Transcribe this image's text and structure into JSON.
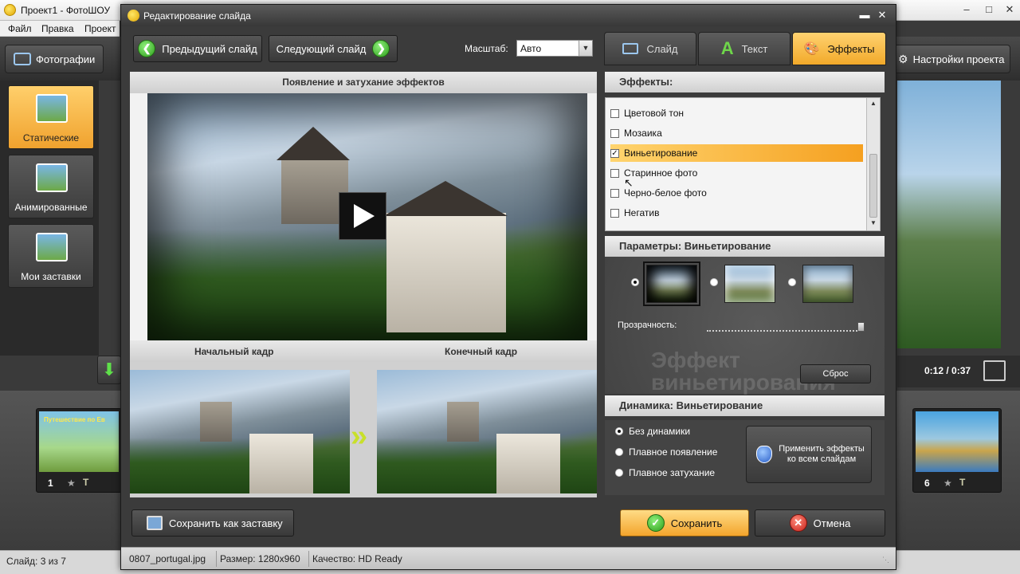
{
  "main_window": {
    "title": "Проект1 - ФотоШОУ",
    "menu": [
      "Файл",
      "Правка",
      "Проект"
    ],
    "toolbar": {
      "photos_label": "Фотографии",
      "settings_label": "Настройки проекта"
    },
    "categories": [
      {
        "label": "Статические",
        "active": true
      },
      {
        "label": "Анимированные",
        "active": false
      },
      {
        "label": "Мои заставки",
        "active": false
      }
    ],
    "playback_time": "0:12 / 0:37",
    "filmstrip": {
      "thumb1_caption": "Путешествие по Ев",
      "thumb1_number": "1",
      "thumb_last_number": "6"
    },
    "status": "Слайд: 3 из 7"
  },
  "dialog": {
    "title": "Редактирование слайда",
    "prev_slide": "Предыдущий слайд",
    "next_slide": "Следующий слайд",
    "zoom_label": "Масштаб:",
    "zoom_value": "Авто",
    "preview_header": "Появление и затухание эффектов",
    "start_frame": "Начальный кадр",
    "end_frame": "Конечный кадр",
    "tabs": [
      {
        "label": "Слайд",
        "icon": "camera-icon",
        "active": false
      },
      {
        "label": "Текст",
        "icon": "text-a-icon",
        "active": false
      },
      {
        "label": "Эффекты",
        "icon": "palette-icon",
        "active": true
      }
    ],
    "effects_header": "Эффекты:",
    "effects": [
      {
        "label": "Цветовой тон",
        "checked": false,
        "selected": false
      },
      {
        "label": "Мозаика",
        "checked": false,
        "selected": false
      },
      {
        "label": "Виньетирование",
        "checked": true,
        "selected": true
      },
      {
        "label": "Старинное фото",
        "checked": false,
        "selected": false
      },
      {
        "label": "Черно-белое фото",
        "checked": false,
        "selected": false
      },
      {
        "label": "Негатив",
        "checked": false,
        "selected": false
      }
    ],
    "params_header": "Параметры: Виньетирование",
    "vignette_selected_option": 1,
    "opacity_label": "Прозрачность:",
    "opacity_value": 1.0,
    "watermark_text": "Эффект виньетирования",
    "reset": "Сброс",
    "dynamics_header": "Динамика: Виньетирование",
    "dynamics": [
      {
        "label": "Без динамики",
        "checked": true
      },
      {
        "label": "Плавное появление",
        "checked": false
      },
      {
        "label": "Плавное затухание",
        "checked": false
      }
    ],
    "apply_all": "Применить эффекты ко всем слайдам",
    "save_as_intro": "Сохранить как заставку",
    "save": "Сохранить",
    "cancel": "Отмена",
    "statusbar": {
      "filename": "0807_portugal.jpg",
      "size": "Размер: 1280x960",
      "quality": "Качество: HD Ready"
    }
  },
  "colors": {
    "accent": "#f2a92a",
    "dark_bg": "#3b3b3b",
    "green": "#2c9d1a",
    "red": "#d8322a"
  }
}
